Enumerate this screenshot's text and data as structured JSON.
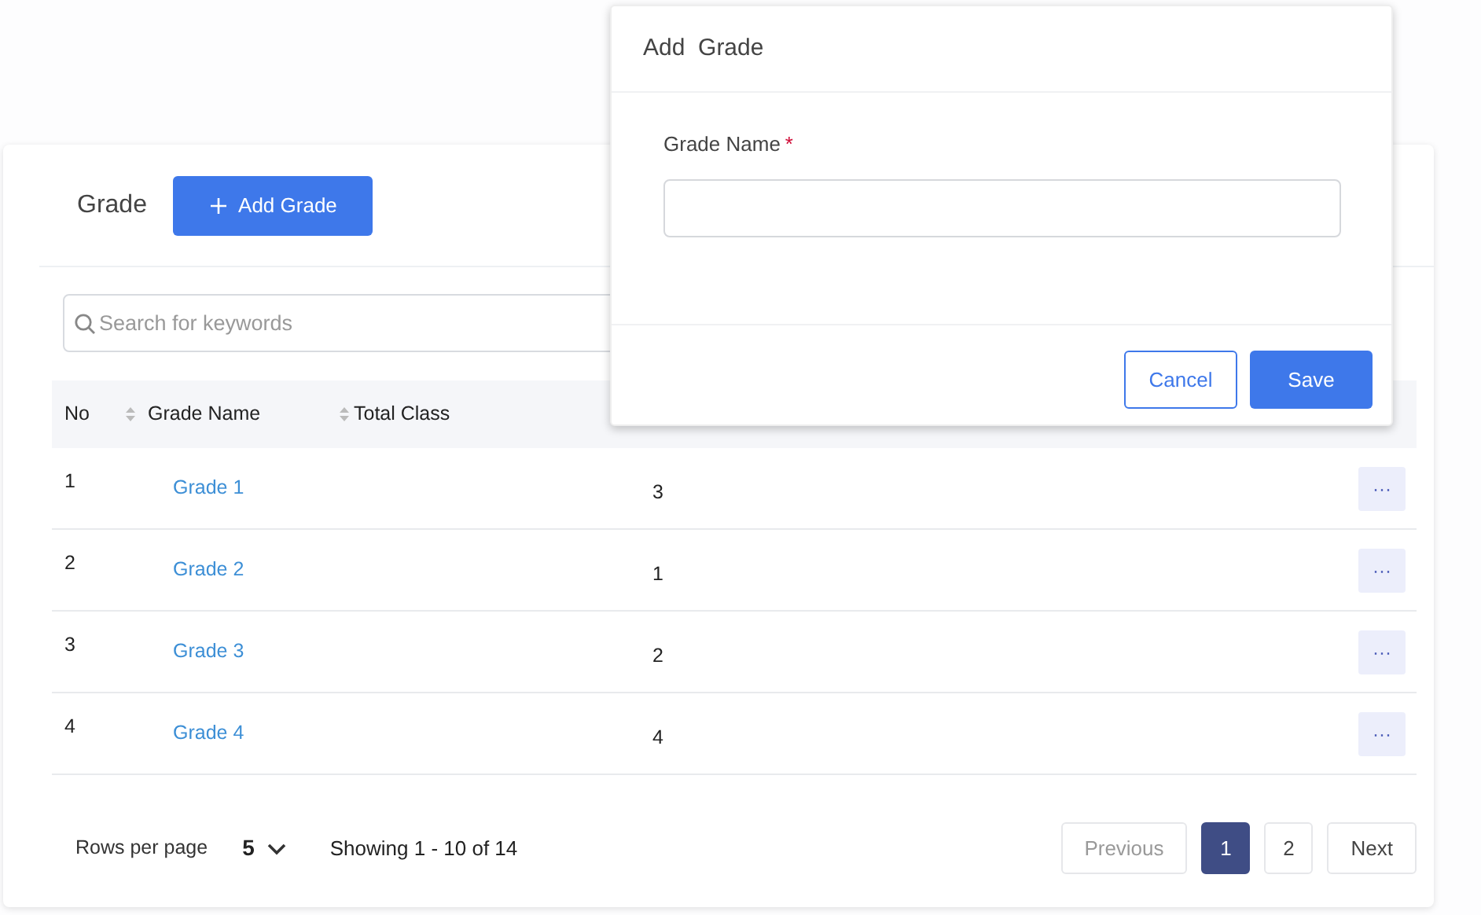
{
  "page": {
    "title": "Grade",
    "add_button": "Add Grade",
    "search": {
      "placeholder": "Search for keywords"
    }
  },
  "table": {
    "columns": [
      "No",
      "Grade Name",
      "Total Class"
    ],
    "rows": [
      {
        "no": "1",
        "name": "Grade 1",
        "total": "3",
        "action": "···"
      },
      {
        "no": "2",
        "name": "Grade 2",
        "total": "1",
        "action": "···"
      },
      {
        "no": "3",
        "name": "Grade 3",
        "total": "2",
        "action": "···"
      },
      {
        "no": "4",
        "name": "Grade 4",
        "total": "4",
        "action": "···"
      }
    ]
  },
  "footer": {
    "rows_label": "Rows per page",
    "rows_value": "5",
    "showing": "Showing 1 - 10 of 14",
    "pagination": [
      {
        "label": "Previous",
        "kind": "nav",
        "disabled": true,
        "selected": false
      },
      {
        "label": "1",
        "kind": "page",
        "disabled": false,
        "selected": true
      },
      {
        "label": "2",
        "kind": "page",
        "disabled": false,
        "selected": false
      },
      {
        "label": "Next",
        "kind": "nav",
        "disabled": false,
        "selected": false
      }
    ]
  },
  "modal": {
    "title": "Add  Grade",
    "field_label": "Grade Name",
    "required_mark": "*",
    "buttons": [
      {
        "label": "Cancel",
        "kind": "secondary"
      },
      {
        "label": "Save",
        "kind": "primary"
      }
    ]
  }
}
